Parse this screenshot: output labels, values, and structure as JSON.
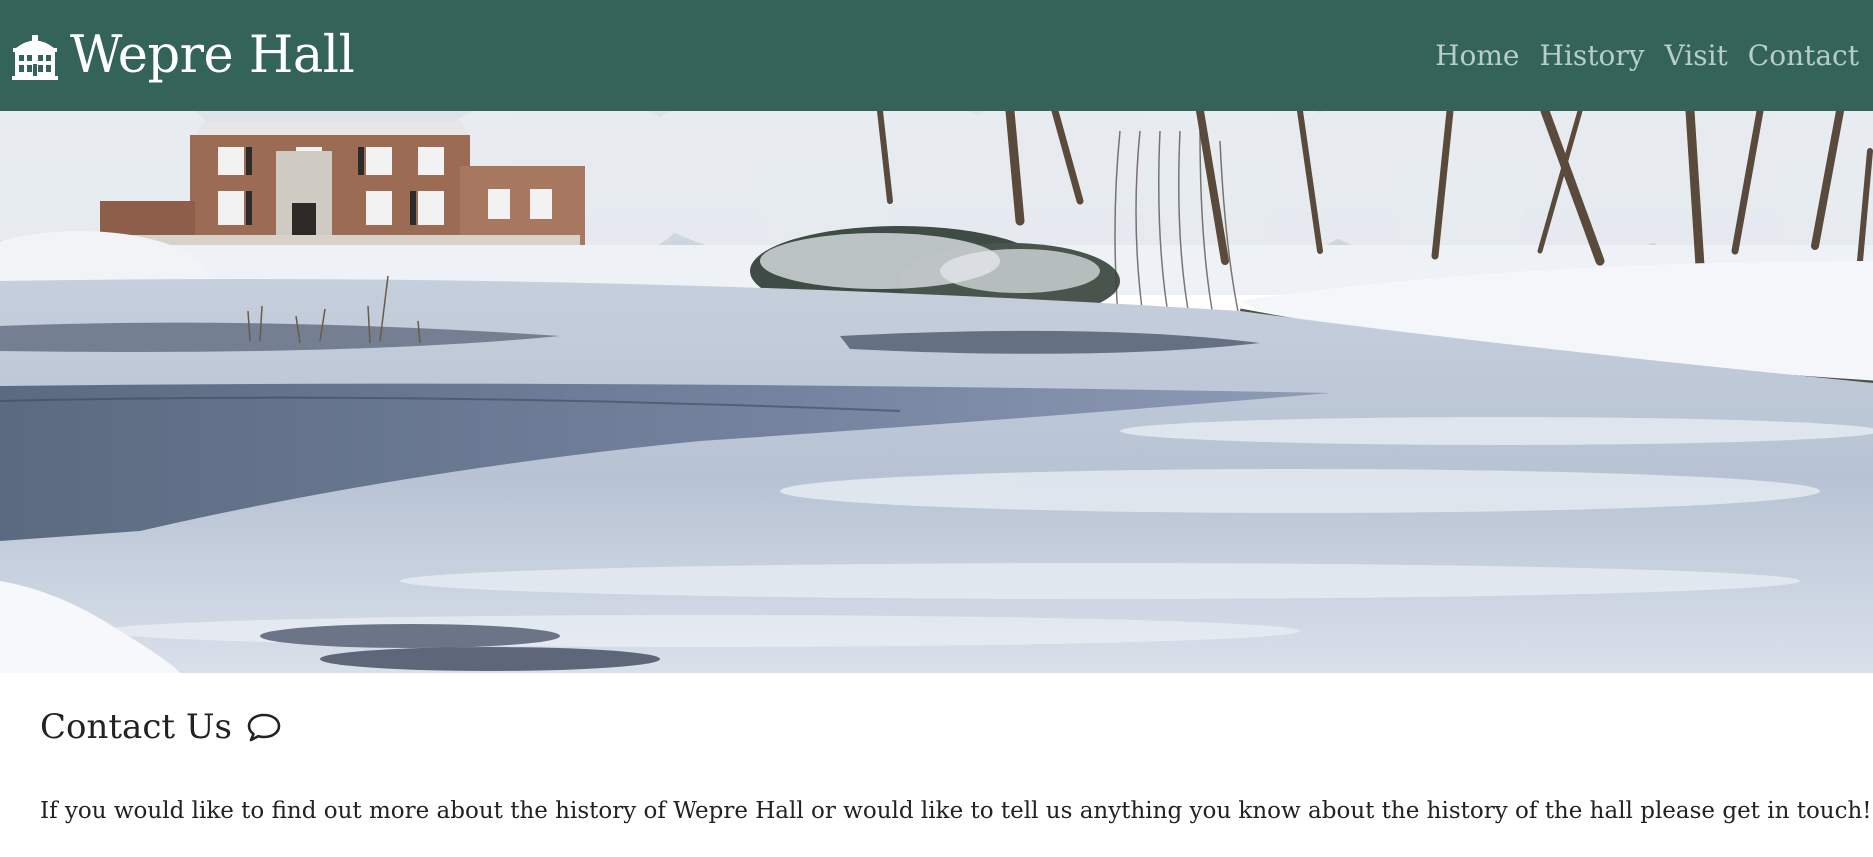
{
  "site": {
    "title": "Wepre Hall",
    "logo_icon": "building-icon",
    "header_bg": "#336359",
    "nav_color": "#b8cdc7"
  },
  "nav": {
    "items": [
      {
        "label": "Home"
      },
      {
        "label": "History"
      },
      {
        "label": "Visit"
      },
      {
        "label": "Contact"
      }
    ]
  },
  "hero": {
    "image": "snowy-park-frozen-lake-icon"
  },
  "contact": {
    "heading": "Contact Us",
    "heading_icon": "chat-bubble-icon",
    "intro": "If you would like to find out more about the history of Wepre Hall or would like to tell us anything you know about the history of the hall please get in touch!"
  }
}
